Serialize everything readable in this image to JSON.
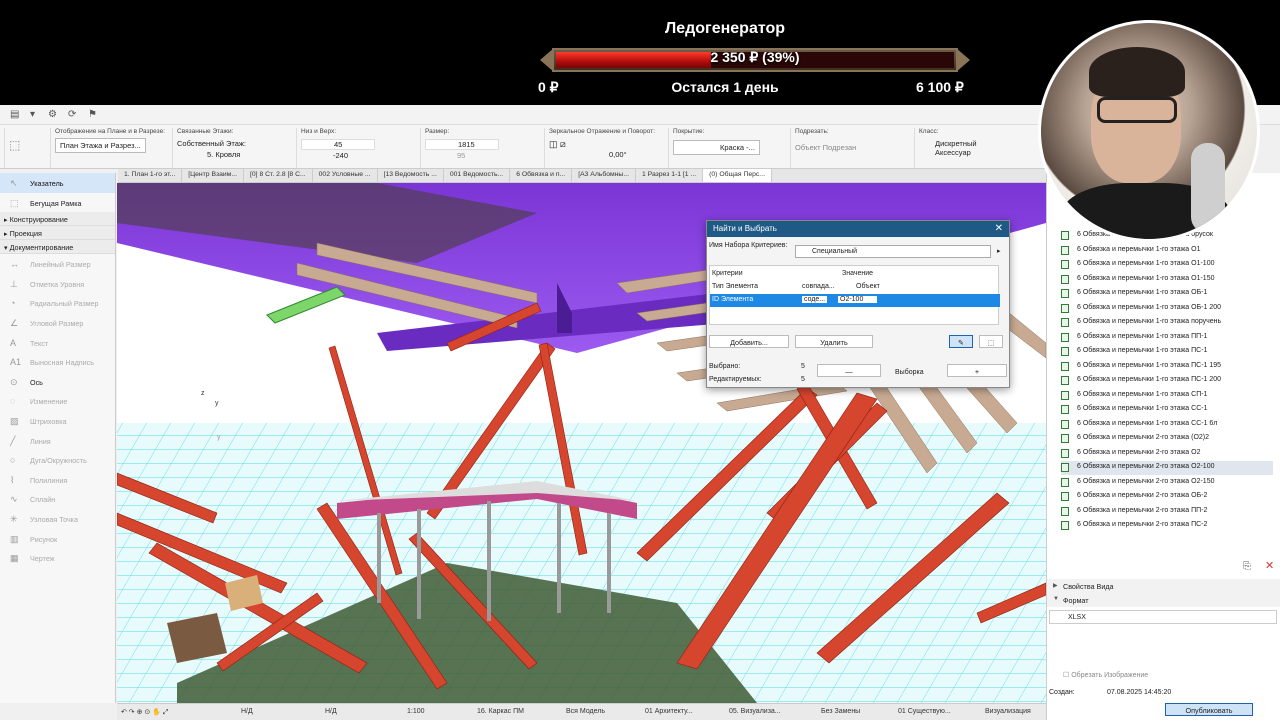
{
  "overlay": {
    "title": "Ледогенератор",
    "amount": "2 350 ₽ (39%)",
    "progress": 0.39,
    "min": "0 ₽",
    "remaining": "Остался 1 день",
    "max": "6 100 ₽"
  },
  "infobox": {
    "display_label": "Отображение на Плане и в Разрезе:",
    "display_value": "План Этажа и Разрез...",
    "stories_label": "Связанные Этажи:",
    "home_story": "Собственный Этаж:",
    "home_story_value": "5. Кровля",
    "bottom_top_label": "Низ и Верх:",
    "top_value": "45",
    "bottom_value": "-240",
    "size_label": "Размер:",
    "size_a": "1815",
    "size_b": "95",
    "mirror_label": "Зеркальное Отражение и Поворот:",
    "angle": "0,00°",
    "surface_label": "Покрытие:",
    "surface_value": "Краска -...",
    "subtype_label": "Подрезать:",
    "subtype_value": "Объект Подрезан",
    "class_label": "Класс:",
    "class_value": "Дискретный Аксессуар"
  },
  "tabs": [
    "1. План 1-го эт...",
    "[Центр Взаим...",
    "[0] 8 Ст. 2.8 [8 С...",
    "002 Условные ...",
    "[13 Ведомость ...",
    "001 Ведомость...",
    "6 Обвязка и п...",
    "[A3 Альбомны...",
    "1 Разрез 1-1 [1 ...",
    "(0) Общая Перс..."
  ],
  "toolbox": {
    "pointer": "Указатель",
    "marquee": "Бегущая Рамка",
    "sec_design": "Конструирование",
    "sec_projection": "Проекция",
    "sec_documentation": "Документирование",
    "tools": [
      "Линейный Размер",
      "Отметка Уровня",
      "Радиальный Размер",
      "Угловой Размер",
      "Текст",
      "Выносная Надпись",
      "Ось",
      "Изменение",
      "Штриховка",
      "Линия",
      "Дуга/Окружность",
      "Полилиния",
      "Сплайн",
      "Узловая Точка",
      "Рисунок",
      "Чертеж"
    ]
  },
  "dialog": {
    "title": "Найти и Выбрать",
    "criteria_set_label": "Имя Набора Критериев:",
    "criteria_set_value": "Специальный",
    "col_criteria": "Критерии",
    "col_value": "Значение",
    "row1_criteria": "Тип Элемента",
    "row1_op": "совпада...",
    "row1_value": "Объект",
    "row2_criteria": "ID Элемента",
    "row2_op": "соде...",
    "row2_value": "O2-100",
    "add": "Добавить...",
    "remove": "Удалить",
    "selected_label": "Выбрано:",
    "selected_count": "5",
    "editable_label": "Редактируемых:",
    "editable_count": "5",
    "minus": "—",
    "selection": "Выборка",
    "plus": "+"
  },
  "rpanel": {
    "items": [
      "6 Обвязка и перемычки 1-го этажа брусок",
      "6 Обвязка и перемычки 1-го этажа O1",
      "6 Обвязка и перемычки 1-го этажа O1-100",
      "6 Обвязка и перемычки 1-го этажа O1-150",
      "6 Обвязка и перемычки 1-го этажа OБ-1",
      "6 Обвязка и перемычки 1-го этажа OБ-1 200",
      "6 Обвязка и перемычки 1-го этажа поручень",
      "6 Обвязка и перемычки 1-го этажа ПП-1",
      "6 Обвязка и перемычки 1-го этажа ПС-1",
      "6 Обвязка и перемычки 1-го этажа ПС-1 195",
      "6 Обвязка и перемычки 1-го этажа ПС-1 200",
      "6 Обвязка и перемычки 1-го этажа СП-1",
      "6 Обвязка и перемычки 1-го этажа СС-1",
      "6 Обвязка и перемычки 1-го этажа СС-1 6л",
      "6 Обвязка и перемычки 2-го этажа (O2)2",
      "6 Обвязка и перемычки 2-го этажа O2",
      "6 Обвязка и перемычки 2-го этажа O2-100",
      "6 Обвязка и перемычки 2-го этажа O2-150",
      "6 Обвязка и перемычки 2-го этажа OБ-2",
      "6 Обвязка и перемычки 2-го этажа ПП-2",
      "6 Обвязка и перемычки 2-го этажа ПС-2"
    ],
    "selected_index": 16,
    "view_props": "Свойства Вида",
    "format_label": "Формат",
    "format_value": "XLSX",
    "crop_image": "Обрезать Изображение",
    "created_label": "Создан:",
    "created_value": "07.08.2025 14:45:20",
    "publish": "Опубликовать"
  },
  "statusbar": {
    "nd1": "Н/Д",
    "nd2": "Н/Д",
    "scale": "1:100",
    "layer_combo": "16. Каркас ПМ",
    "model": "Вся Модель",
    "mvo": "01 Архитекту...",
    "graphic": "05. Визуализа...",
    "renovation": "Без Замены",
    "renov_filter": "01 Существую...",
    "view": "Визуализация"
  },
  "axes": {
    "z": "z",
    "y": "y"
  }
}
